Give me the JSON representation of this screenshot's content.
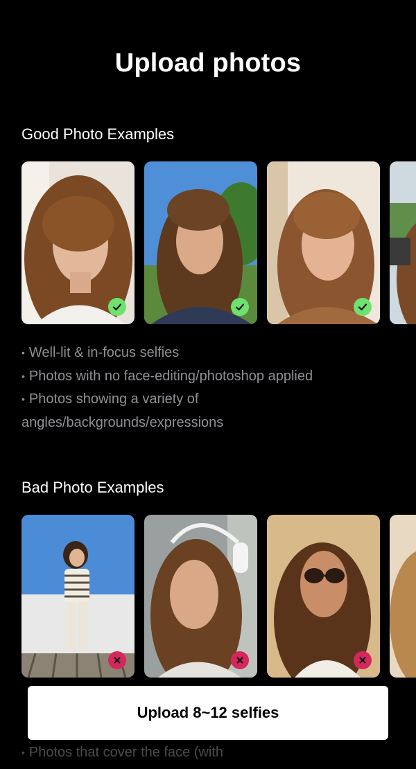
{
  "page": {
    "title": "Upload photos"
  },
  "good": {
    "heading": "Good Photo Examples",
    "tips": [
      "Well-lit & in-focus selfies",
      "Photos with no face-editing/photoshop applied",
      "Photos showing a variety of angles/backgrounds/expressions"
    ],
    "badge_icon": "check-icon",
    "badge_color": "#6ee26e"
  },
  "bad": {
    "heading": "Bad Photo Examples",
    "tips": [
      "Photos that cover the face (with"
    ],
    "badge_icon": "close-icon",
    "badge_color": "#d4275e"
  },
  "upload": {
    "label": "Upload 8~12 selfies"
  }
}
